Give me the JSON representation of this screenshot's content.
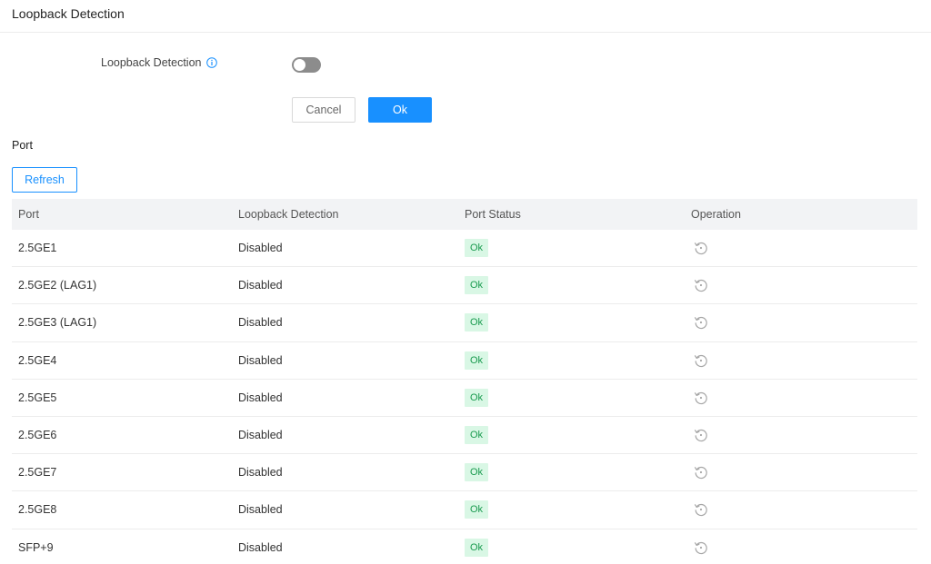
{
  "header": {
    "title": "Loopback Detection"
  },
  "settings": {
    "loopback_label": "Loopback Detection",
    "loopback_enabled": false,
    "cancel_label": "Cancel",
    "ok_label": "Ok"
  },
  "port_section": {
    "title": "Port",
    "refresh_label": "Refresh",
    "columns": [
      "Port",
      "Loopback Detection",
      "Port Status",
      "Operation"
    ],
    "rows": [
      {
        "port": "2.5GE1",
        "loopback": "Disabled",
        "status": "Ok"
      },
      {
        "port": "2.5GE2 (LAG1)",
        "loopback": "Disabled",
        "status": "Ok"
      },
      {
        "port": "2.5GE3 (LAG1)",
        "loopback": "Disabled",
        "status": "Ok"
      },
      {
        "port": "2.5GE4",
        "loopback": "Disabled",
        "status": "Ok"
      },
      {
        "port": "2.5GE5",
        "loopback": "Disabled",
        "status": "Ok"
      },
      {
        "port": "2.5GE6",
        "loopback": "Disabled",
        "status": "Ok"
      },
      {
        "port": "2.5GE7",
        "loopback": "Disabled",
        "status": "Ok"
      },
      {
        "port": "2.5GE8",
        "loopback": "Disabled",
        "status": "Ok"
      },
      {
        "port": "SFP+9",
        "loopback": "Disabled",
        "status": "Ok"
      }
    ]
  },
  "icons": {
    "info": "info-icon",
    "operation": "reset-icon"
  },
  "colors": {
    "primary": "#1890ff",
    "status_ok_bg": "#d9f7e5",
    "status_ok_text": "#1a9b4f",
    "toggle_off": "#8c8c8c"
  }
}
